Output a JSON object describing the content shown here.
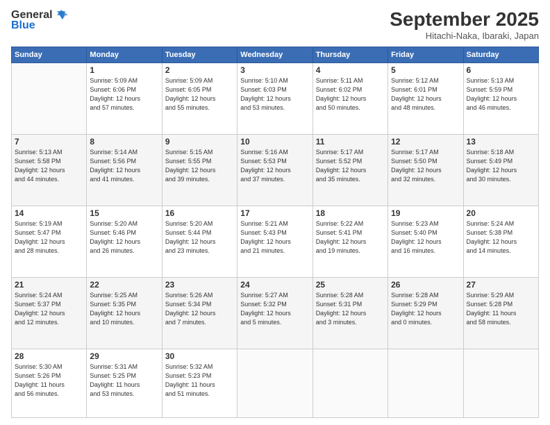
{
  "header": {
    "logo_text_general": "General",
    "logo_text_blue": "Blue",
    "month": "September 2025",
    "location": "Hitachi-Naka, Ibaraki, Japan"
  },
  "days_of_week": [
    "Sunday",
    "Monday",
    "Tuesday",
    "Wednesday",
    "Thursday",
    "Friday",
    "Saturday"
  ],
  "weeks": [
    [
      {
        "day": "",
        "info": ""
      },
      {
        "day": "1",
        "info": "Sunrise: 5:09 AM\nSunset: 6:06 PM\nDaylight: 12 hours\nand 57 minutes."
      },
      {
        "day": "2",
        "info": "Sunrise: 5:09 AM\nSunset: 6:05 PM\nDaylight: 12 hours\nand 55 minutes."
      },
      {
        "day": "3",
        "info": "Sunrise: 5:10 AM\nSunset: 6:03 PM\nDaylight: 12 hours\nand 53 minutes."
      },
      {
        "day": "4",
        "info": "Sunrise: 5:11 AM\nSunset: 6:02 PM\nDaylight: 12 hours\nand 50 minutes."
      },
      {
        "day": "5",
        "info": "Sunrise: 5:12 AM\nSunset: 6:01 PM\nDaylight: 12 hours\nand 48 minutes."
      },
      {
        "day": "6",
        "info": "Sunrise: 5:13 AM\nSunset: 5:59 PM\nDaylight: 12 hours\nand 46 minutes."
      }
    ],
    [
      {
        "day": "7",
        "info": "Sunrise: 5:13 AM\nSunset: 5:58 PM\nDaylight: 12 hours\nand 44 minutes."
      },
      {
        "day": "8",
        "info": "Sunrise: 5:14 AM\nSunset: 5:56 PM\nDaylight: 12 hours\nand 41 minutes."
      },
      {
        "day": "9",
        "info": "Sunrise: 5:15 AM\nSunset: 5:55 PM\nDaylight: 12 hours\nand 39 minutes."
      },
      {
        "day": "10",
        "info": "Sunrise: 5:16 AM\nSunset: 5:53 PM\nDaylight: 12 hours\nand 37 minutes."
      },
      {
        "day": "11",
        "info": "Sunrise: 5:17 AM\nSunset: 5:52 PM\nDaylight: 12 hours\nand 35 minutes."
      },
      {
        "day": "12",
        "info": "Sunrise: 5:17 AM\nSunset: 5:50 PM\nDaylight: 12 hours\nand 32 minutes."
      },
      {
        "day": "13",
        "info": "Sunrise: 5:18 AM\nSunset: 5:49 PM\nDaylight: 12 hours\nand 30 minutes."
      }
    ],
    [
      {
        "day": "14",
        "info": "Sunrise: 5:19 AM\nSunset: 5:47 PM\nDaylight: 12 hours\nand 28 minutes."
      },
      {
        "day": "15",
        "info": "Sunrise: 5:20 AM\nSunset: 5:46 PM\nDaylight: 12 hours\nand 26 minutes."
      },
      {
        "day": "16",
        "info": "Sunrise: 5:20 AM\nSunset: 5:44 PM\nDaylight: 12 hours\nand 23 minutes."
      },
      {
        "day": "17",
        "info": "Sunrise: 5:21 AM\nSunset: 5:43 PM\nDaylight: 12 hours\nand 21 minutes."
      },
      {
        "day": "18",
        "info": "Sunrise: 5:22 AM\nSunset: 5:41 PM\nDaylight: 12 hours\nand 19 minutes."
      },
      {
        "day": "19",
        "info": "Sunrise: 5:23 AM\nSunset: 5:40 PM\nDaylight: 12 hours\nand 16 minutes."
      },
      {
        "day": "20",
        "info": "Sunrise: 5:24 AM\nSunset: 5:38 PM\nDaylight: 12 hours\nand 14 minutes."
      }
    ],
    [
      {
        "day": "21",
        "info": "Sunrise: 5:24 AM\nSunset: 5:37 PM\nDaylight: 12 hours\nand 12 minutes."
      },
      {
        "day": "22",
        "info": "Sunrise: 5:25 AM\nSunset: 5:35 PM\nDaylight: 12 hours\nand 10 minutes."
      },
      {
        "day": "23",
        "info": "Sunrise: 5:26 AM\nSunset: 5:34 PM\nDaylight: 12 hours\nand 7 minutes."
      },
      {
        "day": "24",
        "info": "Sunrise: 5:27 AM\nSunset: 5:32 PM\nDaylight: 12 hours\nand 5 minutes."
      },
      {
        "day": "25",
        "info": "Sunrise: 5:28 AM\nSunset: 5:31 PM\nDaylight: 12 hours\nand 3 minutes."
      },
      {
        "day": "26",
        "info": "Sunrise: 5:28 AM\nSunset: 5:29 PM\nDaylight: 12 hours\nand 0 minutes."
      },
      {
        "day": "27",
        "info": "Sunrise: 5:29 AM\nSunset: 5:28 PM\nDaylight: 11 hours\nand 58 minutes."
      }
    ],
    [
      {
        "day": "28",
        "info": "Sunrise: 5:30 AM\nSunset: 5:26 PM\nDaylight: 11 hours\nand 56 minutes."
      },
      {
        "day": "29",
        "info": "Sunrise: 5:31 AM\nSunset: 5:25 PM\nDaylight: 11 hours\nand 53 minutes."
      },
      {
        "day": "30",
        "info": "Sunrise: 5:32 AM\nSunset: 5:23 PM\nDaylight: 11 hours\nand 51 minutes."
      },
      {
        "day": "",
        "info": ""
      },
      {
        "day": "",
        "info": ""
      },
      {
        "day": "",
        "info": ""
      },
      {
        "day": "",
        "info": ""
      }
    ]
  ]
}
